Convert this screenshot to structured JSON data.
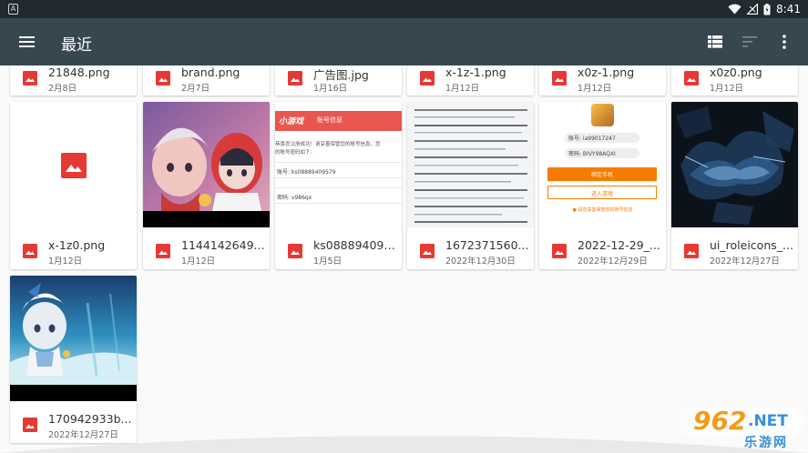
{
  "status_bar": {
    "time": "8:41",
    "notification_glyph": "A",
    "icons": [
      "wifi-icon",
      "signal-icon",
      "battery-icon"
    ]
  },
  "toolbar": {
    "title": "最近",
    "icons": [
      "hamburger-menu-icon",
      "list-view-icon",
      "sort-icon",
      "more-vertical-icon"
    ]
  },
  "files_row0": [
    {
      "name": "21848.png",
      "date": "2月8日"
    },
    {
      "name": "brand.png",
      "date": "2月7日"
    },
    {
      "name": "广告图.jpg",
      "date": "1月16日"
    },
    {
      "name": "x-1z-1.png",
      "date": "1月12日"
    },
    {
      "name": "x0z-1.png",
      "date": "1月12日"
    },
    {
      "name": "x0z0.png",
      "date": "1月12日"
    }
  ],
  "files_row1": [
    {
      "name": "x-1z0.png",
      "date": "1月12日"
    },
    {
      "name": "1144142649...",
      "date": "1月12日"
    },
    {
      "name": "ks088894095...",
      "date": "1月5日"
    },
    {
      "name": "1672371560...",
      "date": "2022年12月30日"
    },
    {
      "name": "2022-12-29_...",
      "date": "2022年12月29日"
    },
    {
      "name": "ui_roleicons_...",
      "date": "2022年12月27日"
    }
  ],
  "files_row2": [
    {
      "name": "170942933b...",
      "date": "2022年12月27日"
    }
  ],
  "thumb_text": {
    "ks_header_brand": "小游戏",
    "ks_header_title": "账号信息",
    "ks_line1": "恭喜您注册成功！请妥善保管您的账号信息，您",
    "ks_line2": "的账号密码如下：",
    "ks_account": "账号: ks08889409579",
    "ks_password": "密码: v986qx",
    "shot_account": "账号: ia99017247",
    "shot_password": "密码: BIVY98AQXI",
    "shot_btn1": "绑定手机",
    "shot_btn2": "进入游戏",
    "shot_note": "● 请您妥善保管您的账号信息"
  },
  "watermark": {
    "number": "962",
    "suffix": ".NET",
    "text": "乐游网"
  },
  "colors": {
    "toolbar": "#37474f",
    "status_bar": "#222a2f",
    "image_icon": "#e53935",
    "accent_orange": "#f57c00"
  }
}
